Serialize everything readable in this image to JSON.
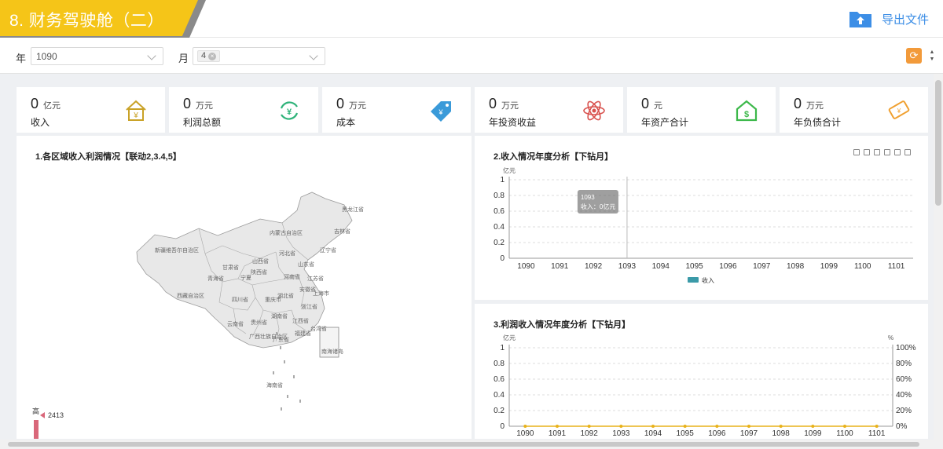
{
  "header": {
    "title": "8. 财务驾驶舱（二）",
    "export_label": "导出文件"
  },
  "filters": {
    "year_label": "年",
    "year_value": "1090",
    "month_label": "月",
    "month_tag": "4"
  },
  "kpis": [
    {
      "value": "0",
      "unit": "亿元",
      "label": "收入",
      "icon": "house-money-icon",
      "color": "#c9a227"
    },
    {
      "value": "0",
      "unit": "万元",
      "label": "利润总额",
      "icon": "yen-cycle-icon",
      "color": "#2fb37a"
    },
    {
      "value": "0",
      "unit": "万元",
      "label": "成本",
      "icon": "price-tag-icon",
      "color": "#3a9ad9"
    },
    {
      "value": "0",
      "unit": "万元",
      "label": "年投资收益",
      "icon": "atom-icon",
      "color": "#d9534f"
    },
    {
      "value": "0",
      "unit": "元",
      "label": "年资产合计",
      "icon": "dollar-house-icon",
      "color": "#3cb84a"
    },
    {
      "value": "0",
      "unit": "万元",
      "label": "年负债合计",
      "icon": "bill-icon",
      "color": "#f0a030"
    }
  ],
  "map_panel": {
    "title": "1.各区域收入利润情况【联动2,3.4,5】",
    "legend_high": "高",
    "legend_max": "2413",
    "regions": [
      {
        "name": "黑龙江省"
      },
      {
        "name": "吉林省"
      },
      {
        "name": "辽宁省"
      },
      {
        "name": "内蒙古自治区"
      },
      {
        "name": "新疆维吾尔自治区"
      },
      {
        "name": "甘肃省"
      },
      {
        "name": "青海省"
      },
      {
        "name": "宁夏"
      },
      {
        "name": "山西省"
      },
      {
        "name": "陕西省"
      },
      {
        "name": "河北省"
      },
      {
        "name": "山东省"
      },
      {
        "name": "河南省"
      },
      {
        "name": "西藏自治区"
      },
      {
        "name": "四川省"
      },
      {
        "name": "重庆市"
      },
      {
        "name": "湖北省"
      },
      {
        "name": "安徽省"
      },
      {
        "name": "江苏省"
      },
      {
        "name": "上海市"
      },
      {
        "name": "浙江省"
      },
      {
        "name": "湖南省"
      },
      {
        "name": "江西省"
      },
      {
        "name": "贵州省"
      },
      {
        "name": "云南省"
      },
      {
        "name": "广西壮族自治区"
      },
      {
        "name": "广东省"
      },
      {
        "name": "福建省"
      },
      {
        "name": "台湾省"
      },
      {
        "name": "海南省"
      },
      {
        "name": "南海诸岛"
      }
    ]
  },
  "colors": {
    "accent_yellow": "#f5c518",
    "link_blue": "#3c8ee6",
    "bar_teal": "#3b9aa8",
    "line_gold": "#e8b21a",
    "refresh_orange": "#f29a3a"
  },
  "chart_data": [
    {
      "type": "bar",
      "title": "2.收入情况年度分析【下钻月】",
      "ylabel": "亿元",
      "categories": [
        "1090",
        "1091",
        "1092",
        "1093",
        "1094",
        "1095",
        "1096",
        "1097",
        "1098",
        "1099",
        "1100",
        "1101"
      ],
      "series": [
        {
          "name": "收入",
          "values": [
            0,
            0,
            0,
            0,
            0,
            0,
            0,
            0,
            0,
            0,
            0,
            0
          ]
        }
      ],
      "ylim": [
        0,
        1
      ],
      "yticks": [
        "0",
        "0.2",
        "0.4",
        "0.6",
        "0.8",
        "1"
      ],
      "grid": true,
      "legend": "bottom",
      "tooltip": {
        "category": "1093",
        "text": "收入：0亿元"
      }
    },
    {
      "type": "line",
      "title": "3.利润收入情况年度分析【下钻月】",
      "ylabel": "亿元",
      "y2label": "%",
      "categories": [
        "1090",
        "1091",
        "1092",
        "1093",
        "1094",
        "1095",
        "1096",
        "1097",
        "1098",
        "1099",
        "1100",
        "1101"
      ],
      "series": [
        {
          "values": [
            0,
            0,
            0,
            0,
            0,
            0,
            0,
            0,
            0,
            0,
            0,
            0
          ]
        }
      ],
      "ylim": [
        0,
        1
      ],
      "yticks": [
        "0",
        "0.2",
        "0.4",
        "0.6",
        "0.8",
        "1"
      ],
      "y2ticks": [
        "0%",
        "20%",
        "40%",
        "60%",
        "80%",
        "100%"
      ],
      "grid": true
    }
  ]
}
